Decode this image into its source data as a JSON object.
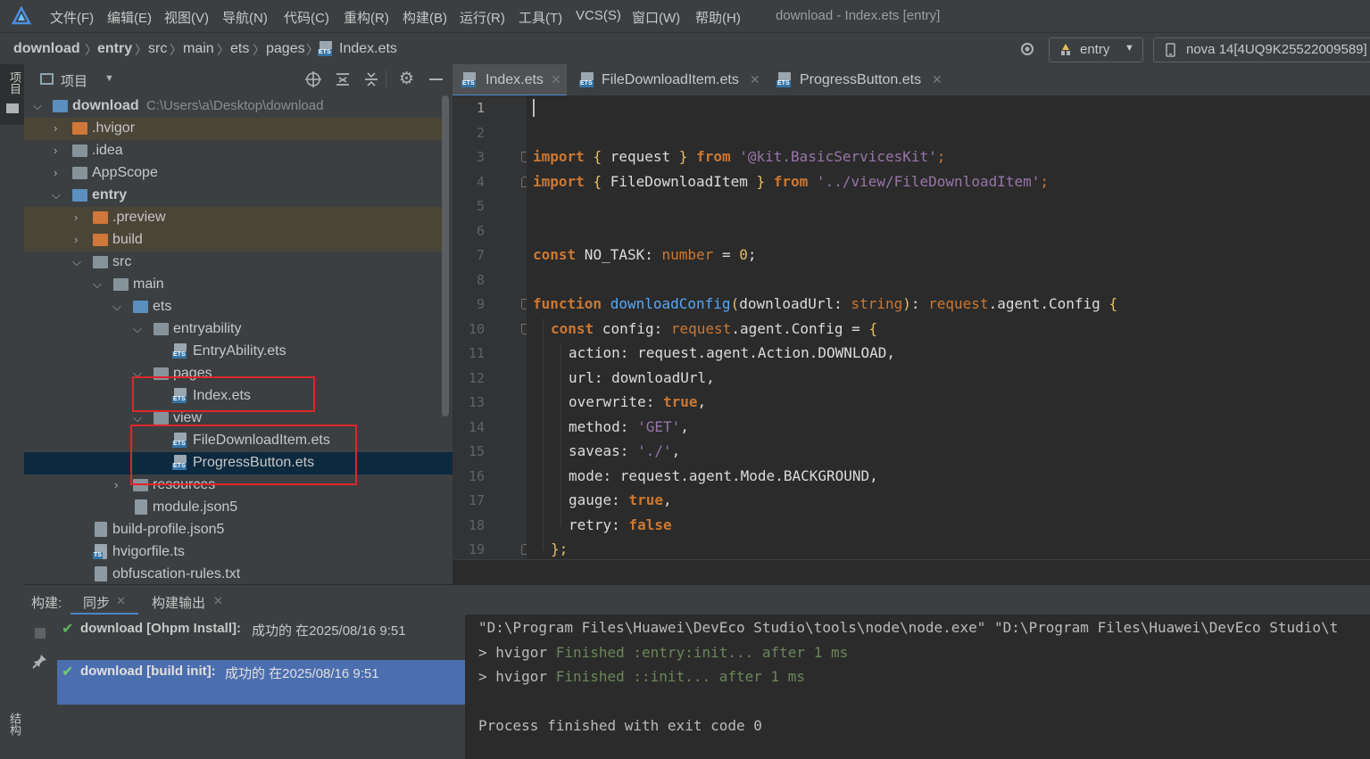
{
  "titlebar": {
    "menus": [
      "文件(F)",
      "编辑(E)",
      "视图(V)",
      "导航(N)",
      "代码(C)",
      "重构(R)",
      "构建(B)",
      "运行(R)",
      "工具(T)",
      "VCS(S)",
      "窗口(W)",
      "帮助(H)"
    ],
    "window_title": "download - Index.ets [entry]"
  },
  "breadcrumb": [
    "download",
    "entry",
    "src",
    "main",
    "ets",
    "pages",
    "Index.ets"
  ],
  "toolbar": {
    "module_selector": "entry",
    "device_selector": "nova 14[4UQ9K25522009589]"
  },
  "left_strip": {
    "project_label": "项目",
    "structure_label": "结构"
  },
  "project_panel": {
    "title": "项目",
    "tree": [
      {
        "label": "download",
        "extra": "C:\\Users\\a\\Desktop\\download",
        "bold": true
      },
      {
        "label": ".hvigor"
      },
      {
        "label": ".idea"
      },
      {
        "label": "AppScope"
      },
      {
        "label": "entry",
        "bold": true
      },
      {
        "label": ".preview"
      },
      {
        "label": "build"
      },
      {
        "label": "src"
      },
      {
        "label": "main"
      },
      {
        "label": "ets"
      },
      {
        "label": "entryability"
      },
      {
        "label": "EntryAbility.ets"
      },
      {
        "label": "pages"
      },
      {
        "label": "Index.ets"
      },
      {
        "label": "view"
      },
      {
        "label": "FileDownloadItem.ets"
      },
      {
        "label": "ProgressButton.ets"
      },
      {
        "label": "resources"
      },
      {
        "label": "module.json5"
      },
      {
        "label": "build-profile.json5"
      },
      {
        "label": "hvigorfile.ts"
      },
      {
        "label": "obfuscation-rules.txt"
      }
    ]
  },
  "editor_tabs": [
    {
      "label": "Index.ets",
      "active": true
    },
    {
      "label": "FileDownloadItem.ets",
      "active": false
    },
    {
      "label": "ProgressButton.ets",
      "active": false
    }
  ],
  "editor": {
    "line_numbers": [
      "1",
      "2",
      "3",
      "4",
      "5",
      "6",
      "7",
      "8",
      "9",
      "10",
      "11",
      "12",
      "13",
      "14",
      "15",
      "16",
      "17",
      "18",
      "19"
    ],
    "code": {
      "l3": {
        "kw1": "import",
        "b1": "{",
        "id": " request ",
        "b2": "}",
        "from": "from",
        "path": "'@kit.BasicServicesKit'",
        "semi": ";"
      },
      "l4": {
        "kw1": "import",
        "b1": "{",
        "id": " FileDownloadItem ",
        "b2": "}",
        "from": "from",
        "path": "'../view/FileDownloadItem'",
        "semi": ";"
      },
      "l7": {
        "kw": "const",
        "name": " NO_TASK",
        "colon": ":",
        "type": " number",
        "eq": " = ",
        "val": "0",
        "semi": ";"
      },
      "l9": {
        "kw": "function",
        "fn": " downloadConfig",
        "p1": "(",
        "param": "downloadUrl",
        "colon": ": ",
        "ptype": "string",
        "p2": ")",
        "colon2": ": ",
        "rtype": "request",
        "rest": ".agent.Config ",
        "brace": "{"
      },
      "l10": {
        "kw": "const",
        "name": " config",
        "colon": ": ",
        "type": "request",
        "rest": ".agent.Config",
        "eq": " = ",
        "brace": "{"
      },
      "l11": {
        "key": "action",
        "rest": ": request.agent.Action.DOWNLOAD,"
      },
      "l12": {
        "key": "url",
        "rest": ": downloadUrl,"
      },
      "l13": {
        "key": "overwrite",
        "colon": ": ",
        "val": "true",
        "comma": ","
      },
      "l14": {
        "key": "method",
        "colon": ": ",
        "val": "'GET'",
        "comma": ","
      },
      "l15": {
        "key": "saveas",
        "colon": ": ",
        "val": "'./'",
        "comma": ","
      },
      "l16": {
        "key": "mode",
        "rest": ": request.agent.Mode.BACKGROUND,"
      },
      "l17": {
        "key": "gauge",
        "colon": ": ",
        "val": "true",
        "comma": ","
      },
      "l18": {
        "key": "retry",
        "colon": ": ",
        "val": "false"
      },
      "l19": {
        "text": "};"
      }
    }
  },
  "build_panel": {
    "label": "构建:",
    "tabs": [
      "同步",
      "构建输出"
    ],
    "items": [
      {
        "name": "download [Ohpm Install]:",
        "status": " 成功的 在2025/08/16 9:51"
      },
      {
        "name": "download [build init]:",
        "status": " 成功的 在2025/08/16 9:51",
        "selected": true
      }
    ]
  },
  "console": {
    "line1": "\"D:\\Program Files\\Huawei\\DevEco Studio\\tools\\node\\node.exe\" \"D:\\Program Files\\Huawei\\DevEco Studio\\t",
    "line2": {
      "prefix": "> hvigor ",
      "msg": "Finished :entry:init... after 1 ms"
    },
    "line3": {
      "prefix": "> hvigor ",
      "msg": "Finished ::init... after 1 ms"
    },
    "line4": "Process finished with exit code 0"
  },
  "colors": {
    "accent": "#4b6eaf",
    "highlight_box": "#e0252a",
    "selection": "#0d293e"
  }
}
